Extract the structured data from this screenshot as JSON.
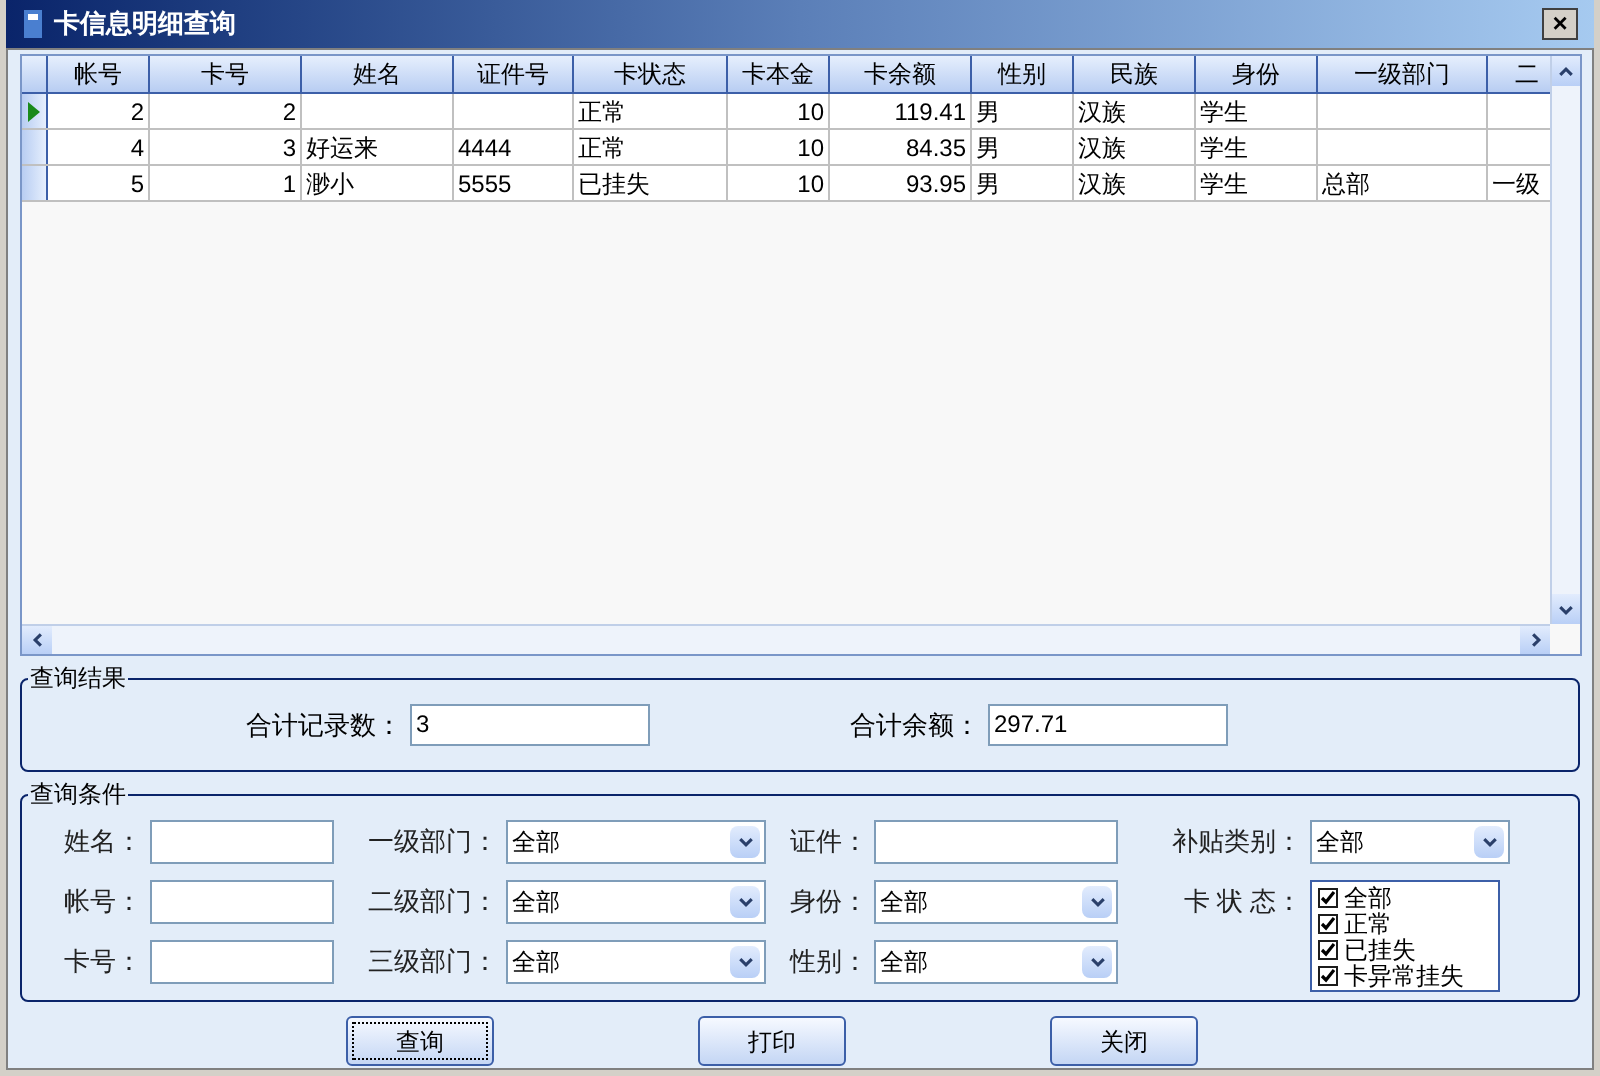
{
  "window": {
    "title": "卡信息明细查询",
    "close": "×"
  },
  "table": {
    "columns": [
      "帐号",
      "卡号",
      "姓名",
      "证件号",
      "卡状态",
      "卡本金",
      "卡余额",
      "性别",
      "民族",
      "身份",
      "一级部门",
      "二"
    ],
    "rows": [
      {
        "current": true,
        "cells": [
          "2",
          "2",
          "",
          "",
          "正常",
          "10",
          "119.41",
          "男",
          "汉族",
          "学生",
          "",
          ""
        ]
      },
      {
        "current": false,
        "cells": [
          "4",
          "3",
          "好运来",
          "4444",
          "正常",
          "10",
          "84.35",
          "男",
          "汉族",
          "学生",
          "",
          ""
        ]
      },
      {
        "current": false,
        "cells": [
          "5",
          "1",
          "渺小",
          "5555",
          "已挂失",
          "10",
          "93.95",
          "男",
          "汉族",
          "学生",
          "总部",
          "一级"
        ]
      }
    ]
  },
  "results": {
    "title": "查询结果",
    "fields": [
      {
        "label": "合计记录数：",
        "value": "3"
      },
      {
        "label": "合计余额：",
        "value": "297.71"
      }
    ]
  },
  "criteria": {
    "title": "查询条件",
    "columns": [
      [
        {
          "kind": "text",
          "label": "姓名："
        },
        {
          "kind": "text",
          "label": "帐号："
        },
        {
          "kind": "text",
          "label": "卡号："
        }
      ],
      [
        {
          "kind": "select",
          "label": "一级部门：",
          "value": "全部"
        },
        {
          "kind": "select",
          "label": "二级部门：",
          "value": "全部"
        },
        {
          "kind": "select",
          "label": "三级部门：",
          "value": "全部"
        }
      ],
      [
        {
          "kind": "text",
          "label": "证件："
        },
        {
          "kind": "select",
          "label": "身份：",
          "value": "全部"
        },
        {
          "kind": "select",
          "label": "性别：",
          "value": "全部"
        }
      ],
      [
        {
          "kind": "select",
          "label": "补贴类别：",
          "value": "全部"
        },
        {
          "kind": "checklist",
          "label": "卡 状 态：",
          "items": [
            {
              "label": "全部",
              "checked": true
            },
            {
              "label": "正常",
              "checked": true
            },
            {
              "label": "已挂失",
              "checked": true
            },
            {
              "label": "卡异常挂失",
              "checked": true
            }
          ]
        }
      ]
    ]
  },
  "buttons": [
    {
      "label": "查询",
      "focused": true
    },
    {
      "label": "打印",
      "focused": false
    },
    {
      "label": "关闭",
      "focused": false
    }
  ]
}
